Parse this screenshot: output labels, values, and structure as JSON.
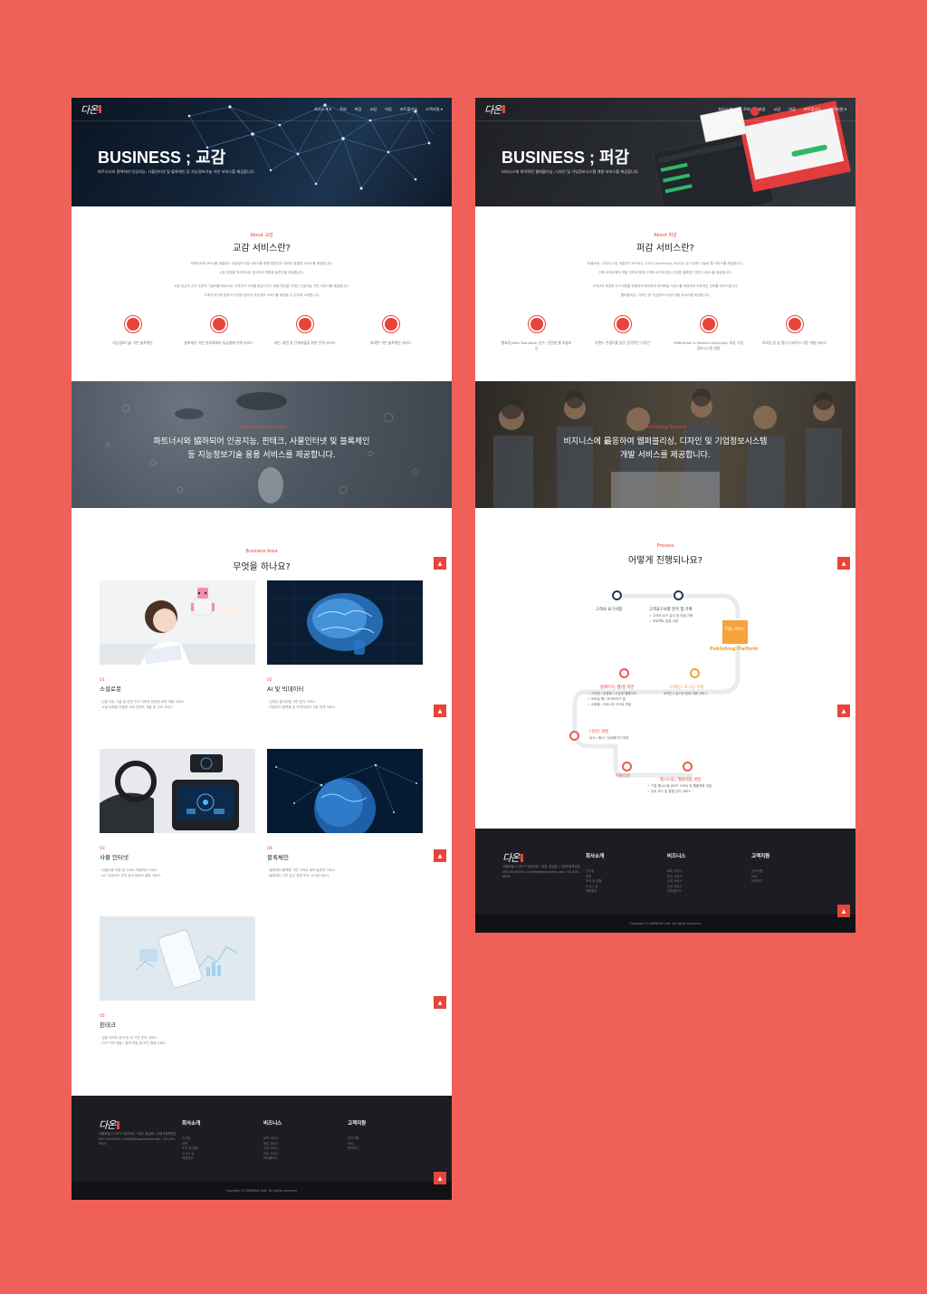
{
  "left": {
    "nav": {
      "logo": "다온",
      "items": [
        "회사소개 ▾",
        "로퍼",
        "퍼감",
        "교감",
        "미감",
        "포트폴리오",
        "고객지원 ▾"
      ]
    },
    "hero": {
      "title": "BUSINESS ; 교감",
      "subtitle": "파트너시와 협력하여 인공지능, 사물인터넷 및 블록체인 등 지능정보기술 기반 서비스를 제공합니다."
    },
    "intro": {
      "eyebrow": "About 교감",
      "title": "교감 서비스란?",
      "text1": "빅데이터와 MOU를 체결하고 지능정보기술 서비스를 위해 협업하여 새로운 융합형 서비스를 제공합니다.",
      "text2": "시장 환경을 적극적으로 분석하여 적합한 솔루션을 제공합니다.",
      "text3": "사람 중심의 사고 수준의 기술력을 바탕으로 고객사의 가치를 향상시키기 위해 최선을 다하는 인공지능 기반 서비스를 제공합니다.",
      "text4": "고객의 요구에 맞추어 다양한 분야의 지능정보 서비스를 제공할 수 있도록 노력합니다.",
      "icons": [
        {
          "icon": "brain-icon",
          "label": "지능정보기술 기반 블록체인"
        },
        {
          "icon": "heart-icon",
          "label": "블록체인 기반 암호화폐의 지급결제 연계 서비스"
        },
        {
          "icon": "home-icon",
          "label": "개인, 회원 및 단체대출을 위한 탄력 서비스"
        },
        {
          "icon": "mobile-icon",
          "label": "비대면 기반 블록체인 서비스"
        }
      ]
    },
    "banner": {
      "eyebrow": "Collaboration Service",
      "line1": "파트너시와 協하되어 인공지능, 핀테크, 사물인터넷 및 블록체인",
      "line2": "등 지능정보기술 융용 서비스를 제공합니다."
    },
    "business": {
      "eyebrow": "Business Area",
      "title": "무엇을 하나요?",
      "cards": [
        {
          "num": "01",
          "title": "소셜로봇",
          "desc1": "- 인공 지능 기술 및 감정 인식 기반의 감성형 로봇 개발 서비스",
          "desc2": "- 소셜 로봇을 이용한 교육 콘텐츠 개발 및 관리 서비스"
        },
        {
          "num": "02",
          "title": "AI 및 빅데이터",
          "desc1": "- 딥러닝 알고리즘 기반 분석 서비스",
          "desc2": "- 빅데이터 플랫폼 및 자연어처리 기술 연계 서비스"
        },
        {
          "num": "03",
          "title": "사물 인터넷",
          "desc1": "- 자율주행 차량 및 스마트 모빌리티 서비스",
          "desc2": "- IoT 디바이스 연계 센서 데이터 통합 서비스"
        },
        {
          "num": "04",
          "title": "블록체인",
          "desc1": "- 블록체인 플랫폼 기반 스마트 계약 솔루션 서비스",
          "desc2": "- 블록체인 기반 분산 원장 보안 시스템 서비스"
        },
        {
          "num": "05",
          "title": "핀테크",
          "desc1": "- 금융 데이터 분석 및 AI 기반 투자 서비스",
          "desc2": "- P2P 기반 대출 / 결제 연동 및 보안 결제 서비스"
        }
      ]
    },
    "footer": {
      "logo": "다온",
      "info": "서울특별시 서초구 강남대로 / 대표: 홍길동 / 사업자등록번호 000-00-00000 / info@daegyeoninfo.com / 02-000-0000",
      "cols": [
        {
          "title": "회사소개",
          "items": [
            "인사말",
            "연혁",
            "조직 및 현황",
            "오시는 길",
            "채용정보"
          ]
        },
        {
          "title": "비즈니스",
          "items": [
            "로퍼 서비스",
            "퍼감 서비스",
            "교감 서비스",
            "미감 서비스",
            "포트폴리오"
          ]
        },
        {
          "title": "고객지원",
          "items": [
            "공지사항",
            "FAQ",
            "문의하기"
          ]
        }
      ],
      "copyright": "Copyright © DAMBAM Soft. All rights reserved."
    }
  },
  "right": {
    "nav": {
      "logo": "다온",
      "items": [
        "회사소개 ▾",
        "로퍼",
        "퍼감",
        "교감",
        "미감",
        "포트폴리오",
        "고객지원 ▾"
      ]
    },
    "hero": {
      "title": "BUSINESS ; 퍼감",
      "subtitle": "비지니스에 최적화된 웹퍼블리싱, 디자인 및 기업정보시스템 개발 서비스를 제공합니다."
    },
    "intro": {
      "eyebrow": "About 퍼감",
      "title": "퍼감 서비스란?",
      "text1": "퍼블리셔, 디자이너 및 개발자가 HTML5, CSS3, JavaScript, MySQL 등 다양한 기술로 웹 서비스를 제공합니다.",
      "text2": "전문 소프트웨어 개발 인력과 함께 고객의 요구에 맞는 다양한 플랫폼 기반의 서비스를 제공합니다.",
      "text3": "고객사의 목표와 요구사항을 정확하게 파악하여 최적화된 서비스를 제공하며 지속적인 관리를 약속드립니다.",
      "text4": "웹퍼블리싱, 디자인 및 기업정보시스템 개발 서비스를 제공합니다.",
      "icons": [
        {
          "icon": "monitor-icon",
          "label": "웹표준(Web Standard) 준수, 반응형 웹 퍼블리싱"
        },
        {
          "icon": "tablet-icon",
          "label": "브랜드 콘셉트를 살린 감각적인 디자인"
        },
        {
          "icon": "phone-icon",
          "label": "SMB(Small & Medium Business) 대상 기업정보시스템 개발"
        },
        {
          "icon": "devices-icon",
          "label": "모바일 앱 및 멀티 디바이스 대응 개발 서비스"
        }
      ]
    },
    "banner": {
      "eyebrow": "Publishing Service",
      "line1": "비지니스에 最응하여 웹퍼블리싱, 디자인 및 기업정보시스템",
      "line2": "개발 서비스를 제공합니다."
    },
    "process": {
      "eyebrow": "Process",
      "title": "어떻게 진행되나요?",
      "steps": {
        "s1": "고객사 요구사항",
        "s2": "고객요구사항 분석 및 기획",
        "s2a": "✓ 고객의 요구 분석 및 컨셉 기획",
        "s2b": "✓ 프로젝트 일정 수립",
        "pub_box": "퍼블 서비스",
        "pub_label": "Publishing Platform",
        "s3": "홈페이지, 웹/앱 개발",
        "s3a": "✓ 기본형 / 맞춤형 / 고급형 웹페이지",
        "s3b": "✓ 모바일 웹 / 하이브리드 앱",
        "s3c": "✓ 쇼핑몰 / 커뮤니티 사이트 개발",
        "s4": "도메인 / 호스팅 구축",
        "s4a": "도메인 / 호스팅 등록 대행 서비스",
        "s5": "디자인 개발",
        "s5a": "로고 / 배너 / 상세페이지 제작",
        "s6": "퍼블리싱",
        "s7": "웹시스템 / 웹플랫폼 개발",
        "s7a": "✓ 기업 웹시스템 (ERP, CRM) 및 웹플랫폼 개발",
        "s7b": "✓ 유지 보수 및 통합 관리 서비스"
      }
    },
    "footer": {
      "logo": "다온",
      "info": "서울특별시 서초구 강남대로 / 대표: 홍길동 / 사업자등록번호 000-00-00000 / info@daegyeoninfo.com / 02-000-0000",
      "cols": [
        {
          "title": "회사소개",
          "items": [
            "인사말",
            "연혁",
            "조직 및 현황",
            "오시는 길",
            "채용정보"
          ]
        },
        {
          "title": "비즈니스",
          "items": [
            "로퍼 서비스",
            "퍼감 서비스",
            "교감 서비스",
            "미감 서비스",
            "포트폴리오"
          ]
        },
        {
          "title": "고객지원",
          "items": [
            "공지사항",
            "FAQ",
            "문의하기"
          ]
        }
      ],
      "copyright": "Copyright © DAMBAM Soft. All rights reserved."
    }
  }
}
